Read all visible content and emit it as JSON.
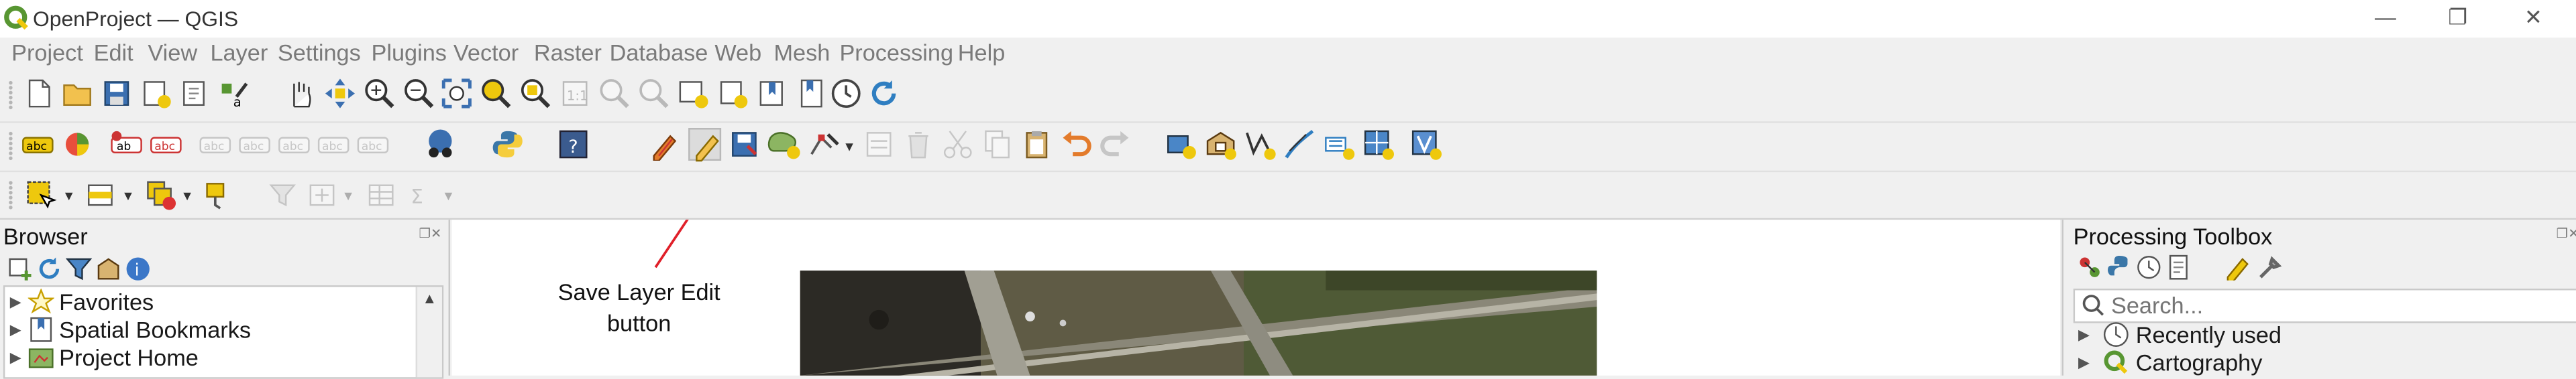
{
  "window": {
    "title": "OpenProject — QGIS",
    "controls": {
      "minimize": "—",
      "restore": "❐",
      "close": "✕"
    }
  },
  "menubar": [
    "Project",
    "Edit",
    "View",
    "Layer",
    "Settings",
    "Plugins",
    "Vector",
    "Raster",
    "Database",
    "Web",
    "Mesh",
    "Processing",
    "Help"
  ],
  "toolbar1": [
    "new-project-icon",
    "open-project-icon",
    "save-project-icon",
    "new-print-layout-icon",
    "layout-manager-icon",
    "style-manager-icon",
    "pan-icon",
    "pan-to-selection-icon",
    "zoom-in-icon",
    "zoom-out-icon",
    "zoom-full-icon",
    "zoom-to-selection-icon",
    "zoom-to-layer-icon",
    "zoom-native-icon",
    "zoom-last-icon",
    "zoom-next-icon",
    "new-map-view-icon",
    "new-bookmark-icon",
    "show-bookmarks-icon",
    "temporal-controller-icon",
    "refresh-icon"
  ],
  "toolbar2": [
    "layer-labeling-icon",
    "layer-diagram-icon",
    "highlight-pinned-labels-icon",
    "toggle-label-display-icon",
    "pin-labels-icon",
    "show-hide-labels-icon",
    "move-label-icon",
    "rotate-label-icon",
    "change-label-icon",
    "identify-features-icon",
    "python-console-icon",
    "help-icon",
    "current-edits-icon",
    "toggle-editing-icon",
    "save-layer-edits-icon",
    "add-polygon-feature-icon",
    "vertex-tool-icon",
    "modify-attributes-icon",
    "delete-selected-icon",
    "cut-features-icon",
    "copy-features-icon",
    "paste-features-icon",
    "undo-icon",
    "redo-icon",
    "digitize-shape-icon",
    "add-ring-icon",
    "add-part-icon",
    "split-features-icon",
    "offset-curve-icon",
    "reshape-features-icon",
    "merge-features-icon",
    "fill-ring-icon"
  ],
  "toolbar3": [
    "select-features-icon",
    "select-by-value-icon",
    "deselect-features-icon",
    "select-by-expression-icon",
    "filter-icon",
    "field-calculator-icon",
    "attribute-table-icon",
    "statistics-icon"
  ],
  "browser": {
    "title": "Browser",
    "controls": "❐✕",
    "tools": [
      "add-layer-icon",
      "refresh-icon",
      "filter-icon",
      "collapse-all-icon",
      "properties-icon"
    ],
    "items": [
      {
        "label": "Favorites",
        "icon": "star-icon"
      },
      {
        "label": "Spatial Bookmarks",
        "icon": "bookmark-icon"
      },
      {
        "label": "Project Home",
        "icon": "project-home-icon"
      }
    ]
  },
  "map": {
    "annotation": "Save Layer Edit button"
  },
  "processing": {
    "title": "Processing Toolbox",
    "controls": "❐✕",
    "tools": [
      "models-icon",
      "python-scripts-icon",
      "history-icon",
      "results-viewer-icon",
      "edit-features-in-place-icon",
      "options-icon"
    ],
    "search_placeholder": "Search...",
    "items": [
      {
        "label": "Recently used",
        "icon": "clock-icon"
      },
      {
        "label": "Cartography",
        "icon": "qgis-icon"
      }
    ]
  },
  "colors": {
    "annotation_arrow": "#e0202a",
    "qgis_green": "#589632",
    "qgis_yellow": "#eec80d"
  }
}
